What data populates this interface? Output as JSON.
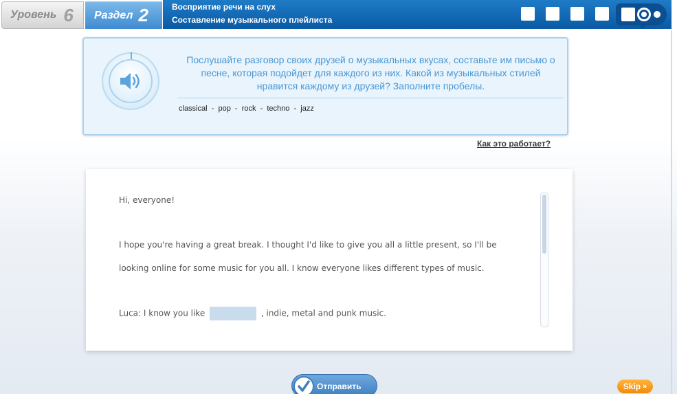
{
  "header": {
    "level_label": "Уровень",
    "level_number": "6",
    "unit_label": "Раздел",
    "unit_number": "2",
    "title_line1": "Восприятие речи на слух",
    "title_line2": "Составление музыкального плейлиста",
    "progress_squares": 5,
    "progress_current_step": 6
  },
  "instruction": {
    "audio_icon": "speaker-icon",
    "text": "Послушайте разговор своих друзей о музыкальных вкусах, составьте им письмо о песне, которая подойдет для каждого из них. Какой из музыкальных стилей нравится каждому из друзей? Заполните пробелы.",
    "word_bank": "classical  -  pop  -  rock  -  techno  -  jazz"
  },
  "help_link": "Как это работает?",
  "letter": {
    "greeting": "Hi, everyone!",
    "para1_line1": "I hope you're having a great break. I thought I'd like to give you all a little present, so I'll be",
    "para1_line2": "looking online for some music for you all. I know everyone likes different types of music.",
    "luca_prefix": "Luca: I know you like",
    "luca_suffix": ", indie, metal and punk music.",
    "scroll_position": 0
  },
  "submit_label": "Отправить",
  "skip_label": "Skip",
  "colors": {
    "header_blue": "#0a5aa4",
    "unit_tab_blue": "#3f8bd1",
    "instruction_text": "#4a97d4",
    "skip_orange": "#f28a0c"
  }
}
